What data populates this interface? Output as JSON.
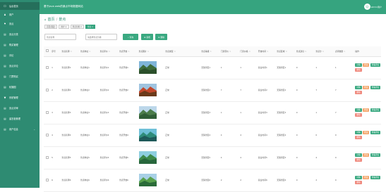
{
  "app": {
    "title": "基于Java web的景点市场数据网站",
    "user": "admin用户"
  },
  "sidebar": {
    "items": [
      {
        "icon": "☐",
        "label": "后台首页",
        "active": true
      },
      {
        "icon": "♟",
        "label": "用户"
      },
      {
        "icon": "⚑",
        "label": "景点"
      },
      {
        "icon": "▤",
        "label": "景点分类"
      },
      {
        "icon": "▤",
        "label": "购买管理"
      },
      {
        "icon": "▤",
        "label": "评论"
      },
      {
        "icon": "▤",
        "label": "景点评论"
      },
      {
        "icon": "▤",
        "label": "门票购买"
      },
      {
        "icon": "▤",
        "label": "轮播图"
      },
      {
        "icon": "▼",
        "label": "系统管理"
      },
      {
        "icon": "▤",
        "label": "景点评审"
      },
      {
        "icon": "▤",
        "label": "留言板管理"
      },
      {
        "icon": "▤",
        "label": "用户信息",
        "caret": "⌄"
      }
    ]
  },
  "breadcrumb": {
    "home": "首页",
    "sep": "/",
    "current": "景点"
  },
  "tags": [
    "首页(固定)",
    "用户 ×",
    "景点分类 ×",
    "景点 ×"
  ],
  "search": {
    "name_placeholder": "景点名称",
    "category_placeholder": "请选择景点分类",
    "search_label": "查询",
    "add_label": "新增",
    "delete_label": "删除"
  },
  "table": {
    "columns": [
      "序号",
      "景点名称",
      "景点地址",
      "景点评价",
      "景点开放",
      "景点图片",
      "景点类型",
      "景点等级",
      "门票原价",
      "门票价格",
      "开放时间",
      "景点区域",
      "景点建议",
      "景点分",
      "点评数量",
      "操作"
    ],
    "rows": [
      {
        "index": "1",
        "name": "景点名称1",
        "address": "景点地址1",
        "review": "景点评价1",
        "open": "景点开放1",
        "type": "正常",
        "level": "无锡景区1",
        "original_price": "1",
        "price": "1",
        "open_time": "营业时间1",
        "region": "无锡景区1",
        "advice": "0",
        "score": "1",
        "count": "1"
      },
      {
        "index": "2",
        "name": "景点名称2",
        "address": "景点地址2",
        "review": "景点评价2",
        "open": "景点开放2",
        "type": "正常",
        "level": "无锡景区2",
        "original_price": "7",
        "price": "7",
        "open_time": "营业时间2",
        "region": "无锡景区2",
        "advice": "0",
        "score": "7",
        "count": "7"
      },
      {
        "index": "3",
        "name": "景点名称3",
        "address": "景点地址3",
        "review": "景点评价3",
        "open": "景点开放3",
        "type": "正常",
        "level": "无锡景区3",
        "original_price": "1",
        "price": "1",
        "open_time": "营业时间3",
        "region": "无锡景区3",
        "advice": "0",
        "score": "1",
        "count": "7"
      },
      {
        "index": "4",
        "name": "景点名称4",
        "address": "景点地址4",
        "review": "景点评价4",
        "open": "景点开放4",
        "type": "正常",
        "level": "无锡景区4",
        "original_price": "4",
        "price": "4",
        "open_time": "营业时间4",
        "region": "无锡景区4",
        "advice": "0",
        "score": "0",
        "count": "0"
      },
      {
        "index": "5",
        "name": "景点名称5",
        "address": "景点地址5",
        "review": "景点评价5",
        "open": "景点开放5",
        "type": "正常",
        "level": "无锡景区5",
        "original_price": "4",
        "price": "4",
        "open_time": "营业时间5",
        "region": "无锡景区5",
        "advice": "0",
        "score": "4",
        "count": "0"
      },
      {
        "index": "6",
        "name": "景点名称6",
        "address": "景点地址6",
        "review": "景点评价6",
        "open": "景点开放6",
        "type": "正常",
        "level": "无锡景区6",
        "original_price": "2",
        "price": "2",
        "open_time": "营业时间6",
        "region": "无锡景区6",
        "advice": "0",
        "score": "2",
        "count": "0"
      }
    ],
    "actions": {
      "detail": "详情",
      "edit": "修改",
      "comment": "查看评论",
      "delete": "删除"
    }
  },
  "colors": {
    "sidebar": "#2e8b72",
    "topbar": "#36a47f",
    "primary": "#3aa981",
    "warning": "#f4a76e",
    "danger": "#f08a7e"
  }
}
